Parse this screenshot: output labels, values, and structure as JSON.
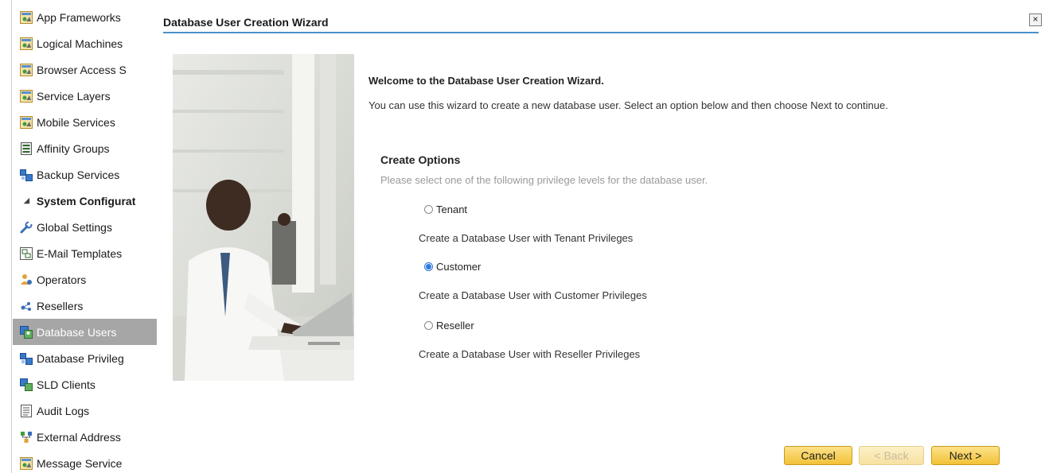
{
  "sidebar": {
    "items": [
      {
        "label": "App Frameworks",
        "icon": "app-window-icon"
      },
      {
        "label": "Logical Machines",
        "icon": "app-window-icon"
      },
      {
        "label": "Browser Access S",
        "icon": "app-window-icon"
      },
      {
        "label": "Service Layers",
        "icon": "app-window-icon"
      },
      {
        "label": "Mobile Services",
        "icon": "app-window-icon"
      },
      {
        "label": "Affinity Groups",
        "icon": "list-icon"
      },
      {
        "label": "Backup Services",
        "icon": "backup-icon"
      },
      {
        "label": "System Configurat",
        "section": true
      },
      {
        "label": "Global Settings",
        "icon": "wrench-icon"
      },
      {
        "label": "E-Mail Templates",
        "icon": "email-template-icon"
      },
      {
        "label": "Operators",
        "icon": "operators-icon"
      },
      {
        "label": "Resellers",
        "icon": "resellers-icon"
      },
      {
        "label": "Database Users",
        "icon": "database-users-icon",
        "selected": true
      },
      {
        "label": "Database Privileg",
        "icon": "database-privileges-icon"
      },
      {
        "label": "SLD Clients",
        "icon": "sld-clients-icon"
      },
      {
        "label": "Audit Logs",
        "icon": "audit-log-icon"
      },
      {
        "label": "External Address",
        "icon": "external-address-icon"
      },
      {
        "label": "Message Service",
        "icon": "app-window-icon"
      }
    ]
  },
  "wizard": {
    "title": "Database User Creation Wizard",
    "welcome_heading": "Welcome to the Database User Creation Wizard.",
    "welcome_text": "You can use this wizard to create a new database user. Select an option below and then choose Next to continue.",
    "options_heading": "Create Options",
    "options_hint": "Please select one of the following privilege levels for the database user.",
    "options": [
      {
        "label": "Tenant",
        "description": "Create a Database User with Tenant Privileges",
        "checked": false
      },
      {
        "label": "Customer",
        "description": "Create a Database User with Customer Privileges",
        "checked": true
      },
      {
        "label": "Reseller",
        "description": "Create a Database User with Reseller Privileges",
        "checked": false
      }
    ],
    "buttons": {
      "cancel": "Cancel",
      "back": "< Back",
      "next": "Next >"
    },
    "close_glyph": "×"
  },
  "colors": {
    "accent_rule": "#4b8fc9",
    "button_fill": "#f2c237",
    "selected_nav": "#a6a6a6"
  }
}
